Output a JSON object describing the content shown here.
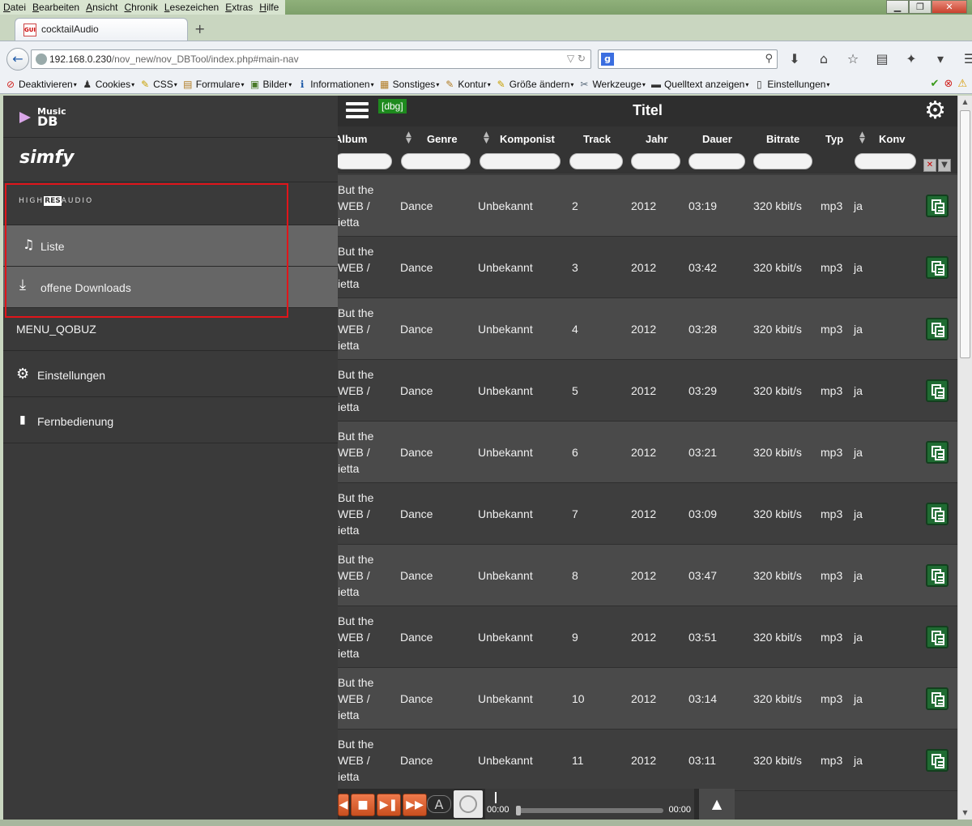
{
  "menubar": {
    "items": [
      "Datei",
      "Bearbeiten",
      "Ansicht",
      "Chronik",
      "Lesezeichen",
      "Extras",
      "Hilfe"
    ]
  },
  "browser": {
    "tab_title": "cocktailAudio",
    "tab_favicon": "GUI",
    "url_host": "192.168.0.230",
    "url_path": "/nov_new/nov_DBTool/index.php#main-nav",
    "search_engine_glyph": "g"
  },
  "bookmarks": [
    {
      "label": "Deaktivieren",
      "icon": "⊘",
      "color": "#d0231f"
    },
    {
      "label": "Cookies",
      "icon": "♟",
      "color": "#333333"
    },
    {
      "label": "CSS",
      "icon": "✎",
      "color": "#c8a000"
    },
    {
      "label": "Formulare",
      "icon": "▤",
      "color": "#b07a20"
    },
    {
      "label": "Bilder",
      "icon": "▣",
      "color": "#4a7a2a"
    },
    {
      "label": "Informationen",
      "icon": "ℹ",
      "color": "#1e5aa8"
    },
    {
      "label": "Sonstiges",
      "icon": "▦",
      "color": "#b07a20"
    },
    {
      "label": "Kontur",
      "icon": "✎",
      "color": "#b07a20"
    },
    {
      "label": "Größe ändern",
      "icon": "✎",
      "color": "#c8a000"
    },
    {
      "label": "Werkzeuge",
      "icon": "✂",
      "color": "#556677"
    },
    {
      "label": "Quelltext anzeigen",
      "icon": "▬",
      "color": "#333333"
    },
    {
      "label": "Einstellungen",
      "icon": "▯",
      "color": "#333333"
    }
  ],
  "sidebar": {
    "musicdb": {
      "line1": "Music",
      "line2": "DB"
    },
    "simfy": "simfy",
    "highresaudio": {
      "pre": "HIGH",
      "mid": "RES",
      "post": "AUDIO"
    },
    "liste": "Liste",
    "downloads": "offene Downloads",
    "qobuz": "MENU_QOBUZ",
    "settings": "Einstellungen",
    "remote": "Fernbedienung"
  },
  "header": {
    "dbg": "[dbg]",
    "title": "Titel"
  },
  "columns": {
    "album": "Album",
    "genre": "Genre",
    "composer": "Komponist",
    "track": "Track",
    "year": "Jahr",
    "duration": "Dauer",
    "bitrate": "Bitrate",
    "type": "Typ",
    "conv": "Konv"
  },
  "rows": [
    {
      "album": [
        "But the",
        "WEB /",
        "ietta"
      ],
      "genre": "Dance",
      "composer": "Unbekannt",
      "track": "2",
      "year": "2012",
      "duration": "03:19",
      "bitrate": "320 kbit/s",
      "type": "mp3",
      "conv": "ja"
    },
    {
      "album": [
        "But the",
        "WEB /",
        "ietta"
      ],
      "genre": "Dance",
      "composer": "Unbekannt",
      "track": "3",
      "year": "2012",
      "duration": "03:42",
      "bitrate": "320 kbit/s",
      "type": "mp3",
      "conv": "ja"
    },
    {
      "album": [
        "But the",
        "WEB /",
        "ietta"
      ],
      "genre": "Dance",
      "composer": "Unbekannt",
      "track": "4",
      "year": "2012",
      "duration": "03:28",
      "bitrate": "320 kbit/s",
      "type": "mp3",
      "conv": "ja"
    },
    {
      "album": [
        "But the",
        "WEB /",
        "ietta"
      ],
      "genre": "Dance",
      "composer": "Unbekannt",
      "track": "5",
      "year": "2012",
      "duration": "03:29",
      "bitrate": "320 kbit/s",
      "type": "mp3",
      "conv": "ja"
    },
    {
      "album": [
        "But the",
        "WEB /",
        "ietta"
      ],
      "genre": "Dance",
      "composer": "Unbekannt",
      "track": "6",
      "year": "2012",
      "duration": "03:21",
      "bitrate": "320 kbit/s",
      "type": "mp3",
      "conv": "ja"
    },
    {
      "album": [
        "But the",
        "WEB /",
        "ietta"
      ],
      "genre": "Dance",
      "composer": "Unbekannt",
      "track": "7",
      "year": "2012",
      "duration": "03:09",
      "bitrate": "320 kbit/s",
      "type": "mp3",
      "conv": "ja"
    },
    {
      "album": [
        "But the",
        "WEB /",
        "ietta"
      ],
      "genre": "Dance",
      "composer": "Unbekannt",
      "track": "8",
      "year": "2012",
      "duration": "03:47",
      "bitrate": "320 kbit/s",
      "type": "mp3",
      "conv": "ja"
    },
    {
      "album": [
        "But the",
        "WEB /",
        "ietta"
      ],
      "genre": "Dance",
      "composer": "Unbekannt",
      "track": "9",
      "year": "2012",
      "duration": "03:51",
      "bitrate": "320 kbit/s",
      "type": "mp3",
      "conv": "ja"
    },
    {
      "album": [
        "But the",
        "WEB /",
        "ietta"
      ],
      "genre": "Dance",
      "composer": "Unbekannt",
      "track": "10",
      "year": "2012",
      "duration": "03:14",
      "bitrate": "320 kbit/s",
      "type": "mp3",
      "conv": "ja"
    },
    {
      "album": [
        "But the",
        "WEB /",
        "ietta"
      ],
      "genre": "Dance",
      "composer": "Unbekannt",
      "track": "11",
      "year": "2012",
      "duration": "03:11",
      "bitrate": "320 kbit/s",
      "type": "mp3",
      "conv": "ja"
    }
  ],
  "player": {
    "time_current": "00:00",
    "time_total": "00:00",
    "repeat_label": "A",
    "progress": 0
  },
  "colors": {
    "highlight_border": "#e0151a",
    "dbg_bg": "#1e8a1e",
    "add_button": "#1f6b32",
    "player_buttons": "#e0643a"
  }
}
